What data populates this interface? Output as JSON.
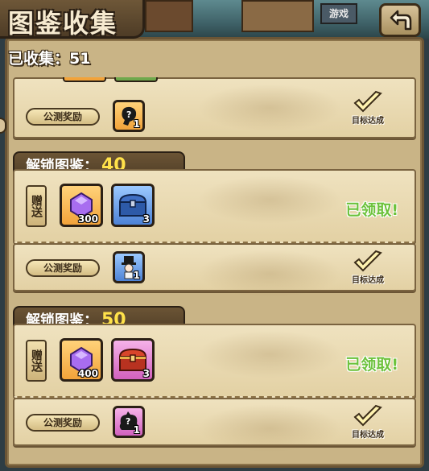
{
  "header": {
    "title": "图鉴收集",
    "top_sign": "游戏",
    "back_icon": "back-arrow-icon"
  },
  "collected": {
    "label": "已收集：",
    "value": "51"
  },
  "tiers": [
    {
      "unlock_label": "",
      "unlock_value": "",
      "beta_reward_label": "公测奖励",
      "beta_reward_item": {
        "icon": "mystery-silhouette-icon",
        "qty": "1",
        "rarity": "orange"
      },
      "done_label": "目标达成"
    },
    {
      "unlock_label": "解锁图鉴：",
      "unlock_value": "40",
      "gift_label": "赠送",
      "gifts": [
        {
          "icon": "purple-gem-icon",
          "qty": "300",
          "rarity": "orange"
        },
        {
          "icon": "blue-chest-icon",
          "qty": "3",
          "rarity": "blue"
        }
      ],
      "claimed_label": "已领取!",
      "beta_reward_label": "公测奖励",
      "beta_reward_item": {
        "icon": "top-hat-character-icon",
        "qty": "1",
        "rarity": "blue"
      },
      "done_label": "目标达成"
    },
    {
      "unlock_label": "解锁图鉴：",
      "unlock_value": "50",
      "gift_label": "赠送",
      "gifts": [
        {
          "icon": "purple-gem-icon",
          "qty": "400",
          "rarity": "orange"
        },
        {
          "icon": "red-chest-icon",
          "qty": "3",
          "rarity": "pink"
        }
      ],
      "claimed_label": "已领取!",
      "beta_reward_label": "公测奖励",
      "beta_reward_item": {
        "icon": "mystery-creature-icon",
        "qty": "1",
        "rarity": "pink"
      },
      "done_label": "目标达成"
    }
  ],
  "colors": {
    "parchment": "#e9dbb3",
    "panel_border": "#6b5535",
    "claimed_green": "#6dc23c",
    "unlock_number_yellow": "#ffe24a"
  }
}
